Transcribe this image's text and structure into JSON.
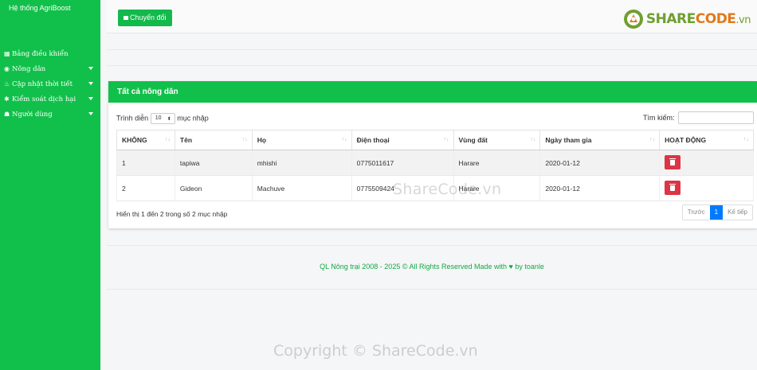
{
  "sidebar": {
    "brand": "Hệ thống AgriBoost",
    "items": [
      {
        "label": "Bảng điều khiển",
        "icon": "grid-icon",
        "glyph": "▦",
        "has_caret": false
      },
      {
        "label": "Nông dân",
        "icon": "user-circle-icon",
        "glyph": "◉",
        "has_caret": true
      },
      {
        "label": "Cập nhật thời tiết",
        "icon": "weather-icon",
        "glyph": "♨",
        "has_caret": true
      },
      {
        "label": "Kiểm soát dịch hại",
        "icon": "bug-icon",
        "glyph": "✱",
        "has_caret": true
      },
      {
        "label": "Người dùng",
        "icon": "users-icon",
        "glyph": "☗",
        "has_caret": true
      }
    ]
  },
  "topbar": {
    "switch_label": "Chuyển đổi",
    "logo": {
      "part1": "SHARE",
      "part2": "CODE",
      "part3": ".vn"
    }
  },
  "card": {
    "title": "Tất cả nông dân",
    "length_prefix": "Trình diễn",
    "length_value": "10",
    "length_suffix": "mục nhập",
    "search_label": "Tìm kiếm:",
    "search_value": "",
    "columns": [
      "KHÔNG",
      "Tên",
      "Họ",
      "Điện thoại",
      "Vùng đất",
      "Ngày tham gia",
      "HOẠT ĐỘNG"
    ],
    "rows": [
      {
        "no": "1",
        "first": "tapiwa",
        "last": "mhishi",
        "phone": "0775011617",
        "region": "Harare",
        "joined": "2020-01-12"
      },
      {
        "no": "2",
        "first": "Gideon",
        "last": "Machuve",
        "phone": "0775509424",
        "region": "Harare",
        "joined": "2020-01-12"
      }
    ],
    "info": "Hiển thị 1 đến 2 trong số 2 mục nhập",
    "pager": {
      "prev": "Trước",
      "current": "1",
      "next": "Kế tiếp"
    }
  },
  "footer": {
    "text": "QL Nông trại 2008 - 2025 © All Rights Reserved Made with ♥ by toanle"
  },
  "watermarks": {
    "center": "ShareCode.vn",
    "bottom": "Copyright © ShareCode.vn"
  },
  "colors": {
    "brand_green": "#11c04a",
    "danger": "#dc3545",
    "primary": "#007bff"
  }
}
